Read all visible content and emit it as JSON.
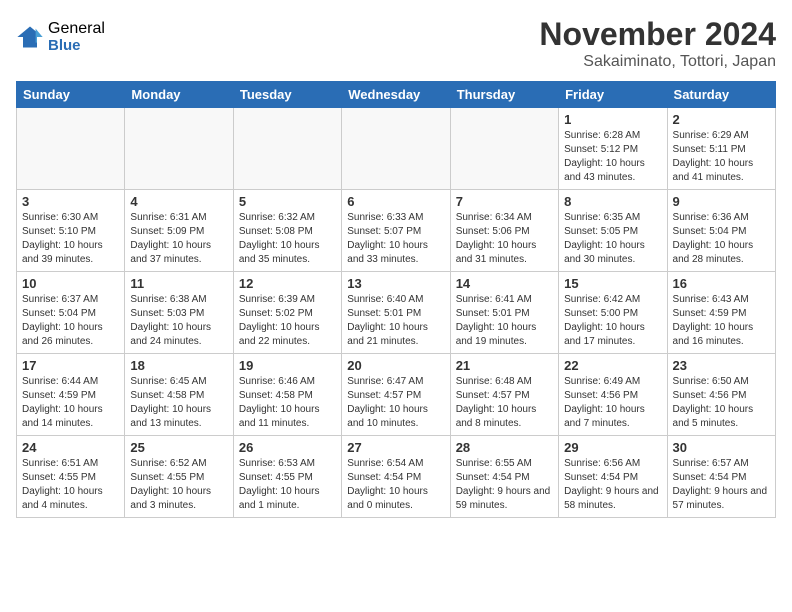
{
  "header": {
    "logo_general": "General",
    "logo_blue": "Blue",
    "month": "November 2024",
    "location": "Sakaiminato, Tottori, Japan"
  },
  "weekdays": [
    "Sunday",
    "Monday",
    "Tuesday",
    "Wednesday",
    "Thursday",
    "Friday",
    "Saturday"
  ],
  "weeks": [
    [
      {
        "day": "",
        "info": ""
      },
      {
        "day": "",
        "info": ""
      },
      {
        "day": "",
        "info": ""
      },
      {
        "day": "",
        "info": ""
      },
      {
        "day": "",
        "info": ""
      },
      {
        "day": "1",
        "info": "Sunrise: 6:28 AM\nSunset: 5:12 PM\nDaylight: 10 hours and 43 minutes."
      },
      {
        "day": "2",
        "info": "Sunrise: 6:29 AM\nSunset: 5:11 PM\nDaylight: 10 hours and 41 minutes."
      }
    ],
    [
      {
        "day": "3",
        "info": "Sunrise: 6:30 AM\nSunset: 5:10 PM\nDaylight: 10 hours and 39 minutes."
      },
      {
        "day": "4",
        "info": "Sunrise: 6:31 AM\nSunset: 5:09 PM\nDaylight: 10 hours and 37 minutes."
      },
      {
        "day": "5",
        "info": "Sunrise: 6:32 AM\nSunset: 5:08 PM\nDaylight: 10 hours and 35 minutes."
      },
      {
        "day": "6",
        "info": "Sunrise: 6:33 AM\nSunset: 5:07 PM\nDaylight: 10 hours and 33 minutes."
      },
      {
        "day": "7",
        "info": "Sunrise: 6:34 AM\nSunset: 5:06 PM\nDaylight: 10 hours and 31 minutes."
      },
      {
        "day": "8",
        "info": "Sunrise: 6:35 AM\nSunset: 5:05 PM\nDaylight: 10 hours and 30 minutes."
      },
      {
        "day": "9",
        "info": "Sunrise: 6:36 AM\nSunset: 5:04 PM\nDaylight: 10 hours and 28 minutes."
      }
    ],
    [
      {
        "day": "10",
        "info": "Sunrise: 6:37 AM\nSunset: 5:04 PM\nDaylight: 10 hours and 26 minutes."
      },
      {
        "day": "11",
        "info": "Sunrise: 6:38 AM\nSunset: 5:03 PM\nDaylight: 10 hours and 24 minutes."
      },
      {
        "day": "12",
        "info": "Sunrise: 6:39 AM\nSunset: 5:02 PM\nDaylight: 10 hours and 22 minutes."
      },
      {
        "day": "13",
        "info": "Sunrise: 6:40 AM\nSunset: 5:01 PM\nDaylight: 10 hours and 21 minutes."
      },
      {
        "day": "14",
        "info": "Sunrise: 6:41 AM\nSunset: 5:01 PM\nDaylight: 10 hours and 19 minutes."
      },
      {
        "day": "15",
        "info": "Sunrise: 6:42 AM\nSunset: 5:00 PM\nDaylight: 10 hours and 17 minutes."
      },
      {
        "day": "16",
        "info": "Sunrise: 6:43 AM\nSunset: 4:59 PM\nDaylight: 10 hours and 16 minutes."
      }
    ],
    [
      {
        "day": "17",
        "info": "Sunrise: 6:44 AM\nSunset: 4:59 PM\nDaylight: 10 hours and 14 minutes."
      },
      {
        "day": "18",
        "info": "Sunrise: 6:45 AM\nSunset: 4:58 PM\nDaylight: 10 hours and 13 minutes."
      },
      {
        "day": "19",
        "info": "Sunrise: 6:46 AM\nSunset: 4:58 PM\nDaylight: 10 hours and 11 minutes."
      },
      {
        "day": "20",
        "info": "Sunrise: 6:47 AM\nSunset: 4:57 PM\nDaylight: 10 hours and 10 minutes."
      },
      {
        "day": "21",
        "info": "Sunrise: 6:48 AM\nSunset: 4:57 PM\nDaylight: 10 hours and 8 minutes."
      },
      {
        "day": "22",
        "info": "Sunrise: 6:49 AM\nSunset: 4:56 PM\nDaylight: 10 hours and 7 minutes."
      },
      {
        "day": "23",
        "info": "Sunrise: 6:50 AM\nSunset: 4:56 PM\nDaylight: 10 hours and 5 minutes."
      }
    ],
    [
      {
        "day": "24",
        "info": "Sunrise: 6:51 AM\nSunset: 4:55 PM\nDaylight: 10 hours and 4 minutes."
      },
      {
        "day": "25",
        "info": "Sunrise: 6:52 AM\nSunset: 4:55 PM\nDaylight: 10 hours and 3 minutes."
      },
      {
        "day": "26",
        "info": "Sunrise: 6:53 AM\nSunset: 4:55 PM\nDaylight: 10 hours and 1 minute."
      },
      {
        "day": "27",
        "info": "Sunrise: 6:54 AM\nSunset: 4:54 PM\nDaylight: 10 hours and 0 minutes."
      },
      {
        "day": "28",
        "info": "Sunrise: 6:55 AM\nSunset: 4:54 PM\nDaylight: 9 hours and 59 minutes."
      },
      {
        "day": "29",
        "info": "Sunrise: 6:56 AM\nSunset: 4:54 PM\nDaylight: 9 hours and 58 minutes."
      },
      {
        "day": "30",
        "info": "Sunrise: 6:57 AM\nSunset: 4:54 PM\nDaylight: 9 hours and 57 minutes."
      }
    ]
  ]
}
